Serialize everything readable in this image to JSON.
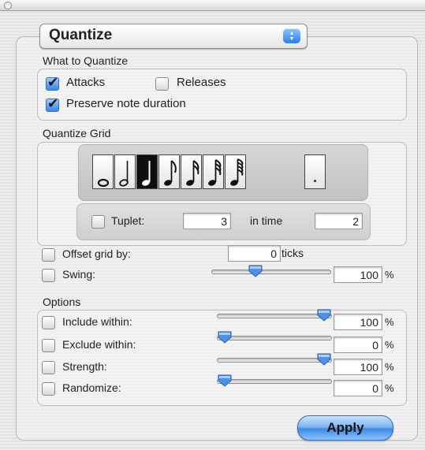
{
  "popup": {
    "selected": "Quantize"
  },
  "what_to_quantize": {
    "title": "What to Quantize",
    "attacks": {
      "label": "Attacks",
      "checked": true
    },
    "releases": {
      "label": "Releases",
      "checked": false
    },
    "preserve": {
      "label": "Preserve note duration",
      "checked": true
    }
  },
  "grid": {
    "title": "Quantize Grid",
    "notes": [
      "whole-note-icon",
      "half-note-icon",
      "quarter-note-icon",
      "eighth-note-icon",
      "sixteenth-note-icon",
      "thirty-second-note-icon",
      "sixty-fourth-note-icon"
    ],
    "selected_index": 2,
    "dot_label": "."
  },
  "tuplet": {
    "label": "Tuplet:",
    "value": "3",
    "in_time_label": "in time",
    "in_time_value": "2",
    "checked": false
  },
  "offset": {
    "label": "Offset grid by:",
    "value": "0",
    "unit": "ticks",
    "checked": false
  },
  "swing": {
    "label": "Swing:",
    "value": "100",
    "unit": "%",
    "checked": false,
    "level": 0.35
  },
  "options": {
    "title": "Options",
    "include": {
      "label": "Include within:",
      "value": "100",
      "unit": "%",
      "checked": false,
      "level": 1.0
    },
    "exclude": {
      "label": "Exclude within:",
      "value": "0",
      "unit": "%",
      "checked": false,
      "level": 0.0
    },
    "strength": {
      "label": "Strength:",
      "value": "100",
      "unit": "%",
      "checked": false,
      "level": 1.0
    },
    "randomize": {
      "label": "Randomize:",
      "value": "0",
      "unit": "%",
      "checked": false,
      "level": 0.0
    }
  },
  "apply": {
    "label": "Apply"
  }
}
